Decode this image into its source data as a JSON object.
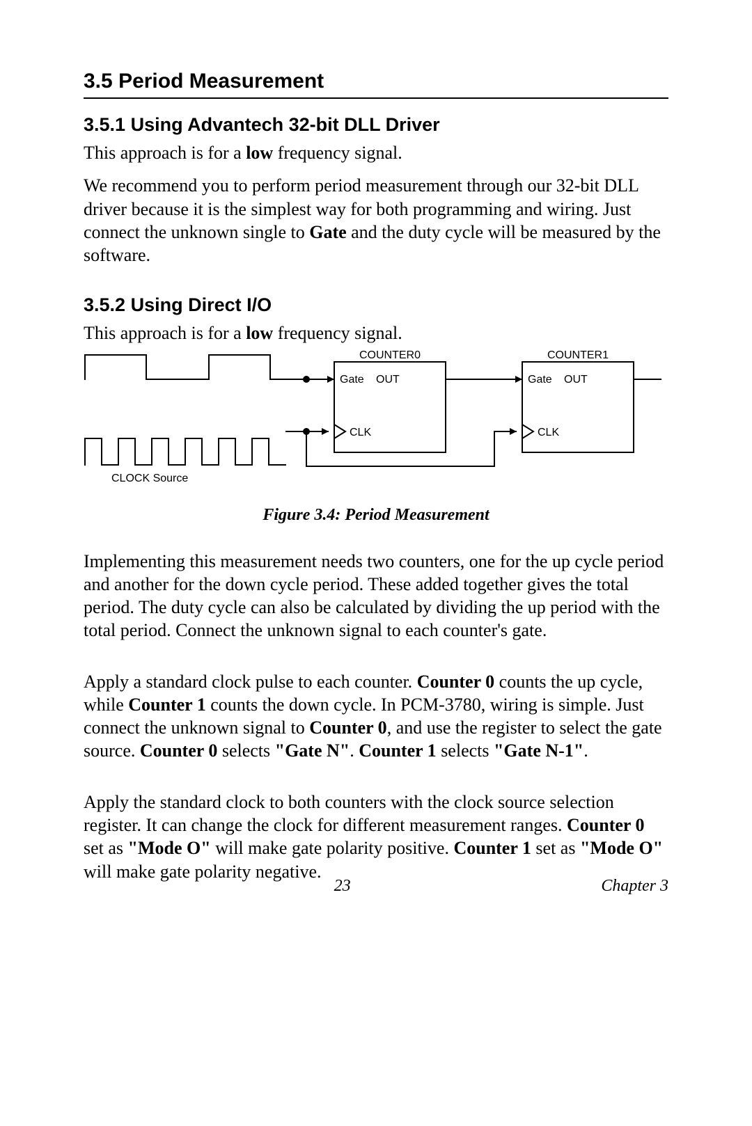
{
  "section": {
    "number": "3.5",
    "title": "Period Measurement"
  },
  "sub1": {
    "number": "3.5.1",
    "title": "Using Advantech 32-bit DLL Driver",
    "p1_a": "This approach is for a ",
    "p1_bold": "low",
    "p1_b": " frequency signal.",
    "p2_a": "We recommend you to perform period measurement through our 32-bit DLL driver because it is the simplest way for both programming and wiring. Just connect the unknown single to ",
    "p2_bold": "Gate",
    "p2_b": " and the duty cycle will be measured by the software."
  },
  "sub2": {
    "number": "3.5.2",
    "title": "Using Direct I/O",
    "p1_a": "This approach is for a ",
    "p1_bold": "low",
    "p1_b": " frequency signal."
  },
  "figure": {
    "caption": "Figure 3.4: Period Measurement",
    "labels": {
      "counter0": "COUNTER0",
      "counter1": "COUNTER1",
      "gate": "Gate",
      "out": "OUT",
      "clk": "CLK",
      "clock_source": "CLOCK Source"
    }
  },
  "para3": "Implementing this measurement needs two counters, one for the up cycle period and another for the down cycle period. These added together gives the total period. The duty cycle can also be calculated by dividing the up period with the total period. Connect the unknown signal to each counter's gate.",
  "para4": {
    "a": "Apply a standard clock pulse to each counter. ",
    "b1": "Counter 0",
    "c": " counts the up cycle, while ",
    "b2": "Counter 1",
    "d": " counts the down cycle. In PCM-3780, wiring is simple. Just connect the unknown signal to ",
    "b3": "Counter 0",
    "e": ", and use the register to select the gate source. ",
    "b4": "Counter 0",
    "f": " selects ",
    "b5": "\"Gate N\"",
    "g": ". ",
    "b6": "Counter 1",
    "h": " selects ",
    "b7": "\"Gate N-1\"",
    "i": "."
  },
  "para5": {
    "a": "Apply the standard clock to both counters with the clock source selection register. It can change the clock for different measurement ranges. ",
    "b1": "Counter 0",
    "b": " set as ",
    "b2": "\"Mode O\"",
    "c": " will make gate polarity positive. ",
    "b3": "Counter 1",
    "d": " set as ",
    "b4": "\"Mode O\"",
    "e": " will make gate polarity negative."
  },
  "footer": {
    "page": "23",
    "chapter": "Chapter 3"
  }
}
